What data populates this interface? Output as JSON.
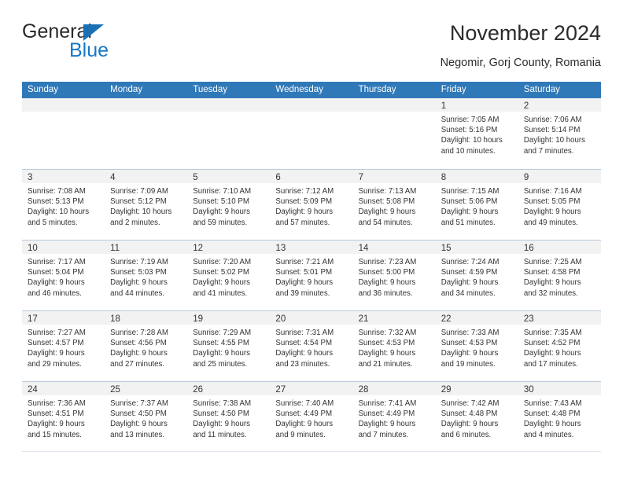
{
  "logo": {
    "word1": "General",
    "word2": "Blue",
    "triangle_color": "#1a6fb5",
    "blue_text_color": "#1878c8"
  },
  "header": {
    "title": "November 2024",
    "subtitle": "Negomir, Gorj County, Romania"
  },
  "theme": {
    "header_bar_color": "#3079b8",
    "daynum_band_color": "#f2f2f2",
    "row_divider_color": "#b9c9da"
  },
  "weekday_headers": [
    "Sunday",
    "Monday",
    "Tuesday",
    "Wednesday",
    "Thursday",
    "Friday",
    "Saturday"
  ],
  "weeks": [
    [
      {
        "day": "",
        "empty": true
      },
      {
        "day": "",
        "empty": true
      },
      {
        "day": "",
        "empty": true
      },
      {
        "day": "",
        "empty": true
      },
      {
        "day": "",
        "empty": true
      },
      {
        "day": "1",
        "sunrise": "Sunrise: 7:05 AM",
        "sunset": "Sunset: 5:16 PM",
        "daylight1": "Daylight: 10 hours",
        "daylight2": "and 10 minutes."
      },
      {
        "day": "2",
        "sunrise": "Sunrise: 7:06 AM",
        "sunset": "Sunset: 5:14 PM",
        "daylight1": "Daylight: 10 hours",
        "daylight2": "and 7 minutes."
      }
    ],
    [
      {
        "day": "3",
        "sunrise": "Sunrise: 7:08 AM",
        "sunset": "Sunset: 5:13 PM",
        "daylight1": "Daylight: 10 hours",
        "daylight2": "and 5 minutes."
      },
      {
        "day": "4",
        "sunrise": "Sunrise: 7:09 AM",
        "sunset": "Sunset: 5:12 PM",
        "daylight1": "Daylight: 10 hours",
        "daylight2": "and 2 minutes."
      },
      {
        "day": "5",
        "sunrise": "Sunrise: 7:10 AM",
        "sunset": "Sunset: 5:10 PM",
        "daylight1": "Daylight: 9 hours",
        "daylight2": "and 59 minutes."
      },
      {
        "day": "6",
        "sunrise": "Sunrise: 7:12 AM",
        "sunset": "Sunset: 5:09 PM",
        "daylight1": "Daylight: 9 hours",
        "daylight2": "and 57 minutes."
      },
      {
        "day": "7",
        "sunrise": "Sunrise: 7:13 AM",
        "sunset": "Sunset: 5:08 PM",
        "daylight1": "Daylight: 9 hours",
        "daylight2": "and 54 minutes."
      },
      {
        "day": "8",
        "sunrise": "Sunrise: 7:15 AM",
        "sunset": "Sunset: 5:06 PM",
        "daylight1": "Daylight: 9 hours",
        "daylight2": "and 51 minutes."
      },
      {
        "day": "9",
        "sunrise": "Sunrise: 7:16 AM",
        "sunset": "Sunset: 5:05 PM",
        "daylight1": "Daylight: 9 hours",
        "daylight2": "and 49 minutes."
      }
    ],
    [
      {
        "day": "10",
        "sunrise": "Sunrise: 7:17 AM",
        "sunset": "Sunset: 5:04 PM",
        "daylight1": "Daylight: 9 hours",
        "daylight2": "and 46 minutes."
      },
      {
        "day": "11",
        "sunrise": "Sunrise: 7:19 AM",
        "sunset": "Sunset: 5:03 PM",
        "daylight1": "Daylight: 9 hours",
        "daylight2": "and 44 minutes."
      },
      {
        "day": "12",
        "sunrise": "Sunrise: 7:20 AM",
        "sunset": "Sunset: 5:02 PM",
        "daylight1": "Daylight: 9 hours",
        "daylight2": "and 41 minutes."
      },
      {
        "day": "13",
        "sunrise": "Sunrise: 7:21 AM",
        "sunset": "Sunset: 5:01 PM",
        "daylight1": "Daylight: 9 hours",
        "daylight2": "and 39 minutes."
      },
      {
        "day": "14",
        "sunrise": "Sunrise: 7:23 AM",
        "sunset": "Sunset: 5:00 PM",
        "daylight1": "Daylight: 9 hours",
        "daylight2": "and 36 minutes."
      },
      {
        "day": "15",
        "sunrise": "Sunrise: 7:24 AM",
        "sunset": "Sunset: 4:59 PM",
        "daylight1": "Daylight: 9 hours",
        "daylight2": "and 34 minutes."
      },
      {
        "day": "16",
        "sunrise": "Sunrise: 7:25 AM",
        "sunset": "Sunset: 4:58 PM",
        "daylight1": "Daylight: 9 hours",
        "daylight2": "and 32 minutes."
      }
    ],
    [
      {
        "day": "17",
        "sunrise": "Sunrise: 7:27 AM",
        "sunset": "Sunset: 4:57 PM",
        "daylight1": "Daylight: 9 hours",
        "daylight2": "and 29 minutes."
      },
      {
        "day": "18",
        "sunrise": "Sunrise: 7:28 AM",
        "sunset": "Sunset: 4:56 PM",
        "daylight1": "Daylight: 9 hours",
        "daylight2": "and 27 minutes."
      },
      {
        "day": "19",
        "sunrise": "Sunrise: 7:29 AM",
        "sunset": "Sunset: 4:55 PM",
        "daylight1": "Daylight: 9 hours",
        "daylight2": "and 25 minutes."
      },
      {
        "day": "20",
        "sunrise": "Sunrise: 7:31 AM",
        "sunset": "Sunset: 4:54 PM",
        "daylight1": "Daylight: 9 hours",
        "daylight2": "and 23 minutes."
      },
      {
        "day": "21",
        "sunrise": "Sunrise: 7:32 AM",
        "sunset": "Sunset: 4:53 PM",
        "daylight1": "Daylight: 9 hours",
        "daylight2": "and 21 minutes."
      },
      {
        "day": "22",
        "sunrise": "Sunrise: 7:33 AM",
        "sunset": "Sunset: 4:53 PM",
        "daylight1": "Daylight: 9 hours",
        "daylight2": "and 19 minutes."
      },
      {
        "day": "23",
        "sunrise": "Sunrise: 7:35 AM",
        "sunset": "Sunset: 4:52 PM",
        "daylight1": "Daylight: 9 hours",
        "daylight2": "and 17 minutes."
      }
    ],
    [
      {
        "day": "24",
        "sunrise": "Sunrise: 7:36 AM",
        "sunset": "Sunset: 4:51 PM",
        "daylight1": "Daylight: 9 hours",
        "daylight2": "and 15 minutes."
      },
      {
        "day": "25",
        "sunrise": "Sunrise: 7:37 AM",
        "sunset": "Sunset: 4:50 PM",
        "daylight1": "Daylight: 9 hours",
        "daylight2": "and 13 minutes."
      },
      {
        "day": "26",
        "sunrise": "Sunrise: 7:38 AM",
        "sunset": "Sunset: 4:50 PM",
        "daylight1": "Daylight: 9 hours",
        "daylight2": "and 11 minutes."
      },
      {
        "day": "27",
        "sunrise": "Sunrise: 7:40 AM",
        "sunset": "Sunset: 4:49 PM",
        "daylight1": "Daylight: 9 hours",
        "daylight2": "and 9 minutes."
      },
      {
        "day": "28",
        "sunrise": "Sunrise: 7:41 AM",
        "sunset": "Sunset: 4:49 PM",
        "daylight1": "Daylight: 9 hours",
        "daylight2": "and 7 minutes."
      },
      {
        "day": "29",
        "sunrise": "Sunrise: 7:42 AM",
        "sunset": "Sunset: 4:48 PM",
        "daylight1": "Daylight: 9 hours",
        "daylight2": "and 6 minutes."
      },
      {
        "day": "30",
        "sunrise": "Sunrise: 7:43 AM",
        "sunset": "Sunset: 4:48 PM",
        "daylight1": "Daylight: 9 hours",
        "daylight2": "and 4 minutes."
      }
    ]
  ]
}
